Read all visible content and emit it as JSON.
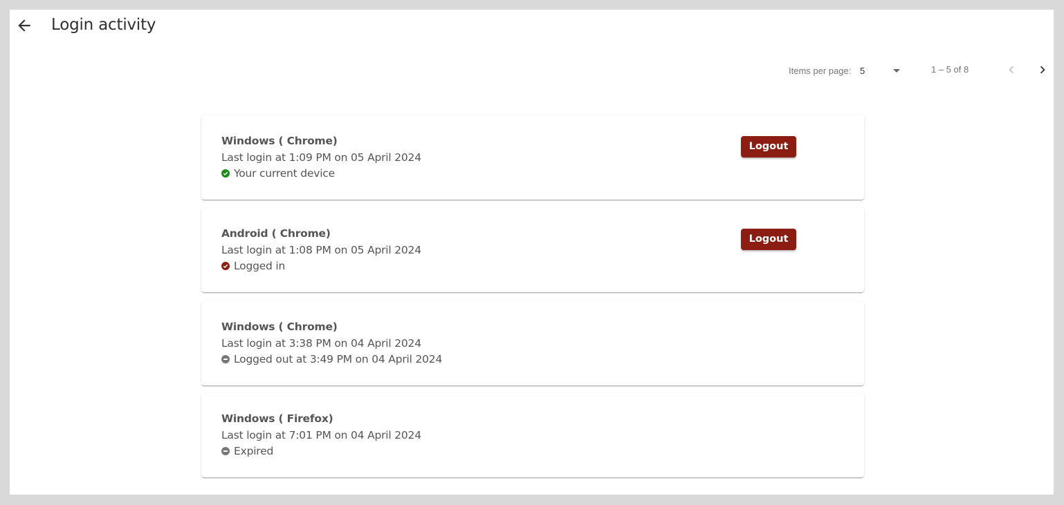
{
  "header": {
    "title": "Login activity",
    "back_icon": "arrow-left-icon"
  },
  "paginator": {
    "items_per_page_label": "Items per page:",
    "items_per_page_value": "5",
    "range_label": "1 – 5 of 8",
    "prev_icon": "chevron-left-icon",
    "next_icon": "chevron-right-icon"
  },
  "sessions": [
    {
      "device": "Windows ( Chrome)",
      "last_login": "Last login at 1:09 PM on 05 April 2024",
      "status": "Your current device",
      "status_icon": "check-circle-icon",
      "status_color": "#1a8a1a",
      "logout_label": "Logout"
    },
    {
      "device": "Android ( Chrome)",
      "last_login": "Last login at 1:08 PM on 05 April 2024",
      "status": "Logged in",
      "status_icon": "check-circle-icon",
      "status_color": "#8b1d12",
      "logout_label": "Logout"
    },
    {
      "device": "Windows ( Chrome)",
      "last_login": "Last login at 3:38 PM on 04 April 2024",
      "status": "Logged out at 3:49 PM on 04 April 2024",
      "status_icon": "minus-circle-icon",
      "status_color": "#777777"
    },
    {
      "device": "Windows ( Firefox)",
      "last_login": "Last login at 7:01 PM on 04 April 2024",
      "status": "Expired",
      "status_icon": "minus-circle-icon",
      "status_color": "#777777"
    }
  ],
  "colors": {
    "accent": "#8b1d12",
    "current_device": "#1a8a1a",
    "inactive": "#777777"
  }
}
